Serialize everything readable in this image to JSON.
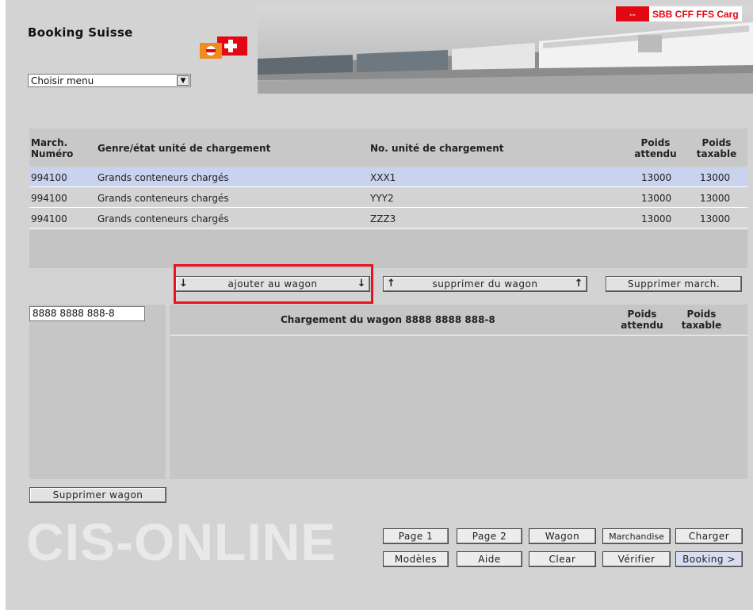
{
  "header": {
    "app_title": "Booking Suisse",
    "brand_text": "SBB CFF FFS Carg",
    "menu_select": {
      "selected": "Choisir menu"
    }
  },
  "upper_table": {
    "columns": [
      "March.\nNuméro",
      "Genre/état unité de chargement",
      "No. unité de chargement",
      "Poids\nattendu",
      "Poids\ntaxable"
    ],
    "rows": [
      {
        "numero": "994100",
        "genre": "Grands conteneurs chargés",
        "unite": "XXX1",
        "attendu": "13000",
        "taxable": "13000",
        "selected": true
      },
      {
        "numero": "994100",
        "genre": "Grands conteneurs chargés",
        "unite": "YYY2",
        "attendu": "13000",
        "taxable": "13000",
        "selected": false
      },
      {
        "numero": "994100",
        "genre": "Grands conteneurs chargés",
        "unite": "ZZZ3",
        "attendu": "13000",
        "taxable": "13000",
        "selected": false
      }
    ]
  },
  "actions": {
    "add_to_wagon": "ajouter au wagon",
    "remove_from_wagon": "supprimer du wagon",
    "delete_march": "Supprimer march."
  },
  "wagon": {
    "number_input": "8888 8888 888-8",
    "heading": "Chargement du wagon 8888 8888 888-8",
    "col_attendu": "Poids\nattendu",
    "col_taxable": "Poids\ntaxable",
    "delete_wagon": "Supprimer wagon"
  },
  "footer": {
    "watermark": "CIS-ONLINE",
    "nav_row1": [
      "Page 1",
      "Page 2",
      "Wagon",
      "Marchandise",
      "Charger"
    ],
    "nav_row2": [
      "Modèles",
      "Aide",
      "Clear",
      "Vérifier",
      "Booking >"
    ]
  },
  "colors": {
    "selection": "#c9d2ee",
    "highlight": "#e8141c",
    "panel": "#d3d3d3",
    "sbb_red": "#e30613"
  },
  "icons": {
    "add": "arrow-down-icon",
    "remove": "arrow-up-icon",
    "dropdown": "chevron-down-icon"
  }
}
